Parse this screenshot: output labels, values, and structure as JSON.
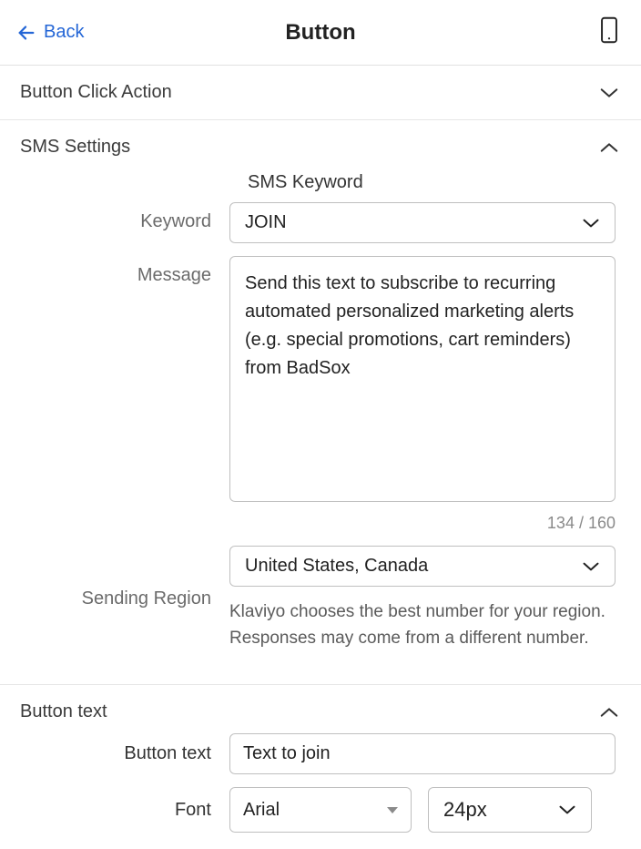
{
  "header": {
    "back_label": "Back",
    "title": "Button"
  },
  "panels": {
    "click_action": {
      "title": "Button Click Action"
    },
    "sms_settings": {
      "title": "SMS Settings",
      "subheading": "SMS Keyword",
      "keyword": {
        "label": "Keyword",
        "value": "JOIN"
      },
      "message": {
        "label": "Message",
        "value": "Send this text to subscribe to recurring automated personalized marketing alerts (e.g. special promotions, cart reminders) from BadSox",
        "char_count": "134 / 160"
      },
      "region": {
        "label": "Sending Region",
        "value": "United States, Canada",
        "help": "Klaviyo chooses the best number for your region. Responses may come from a different number."
      }
    },
    "button_text": {
      "title": "Button text",
      "text": {
        "label": "Button text",
        "value": "Text to join"
      },
      "font": {
        "label": "Font",
        "family": "Arial",
        "size": "24px"
      }
    }
  }
}
